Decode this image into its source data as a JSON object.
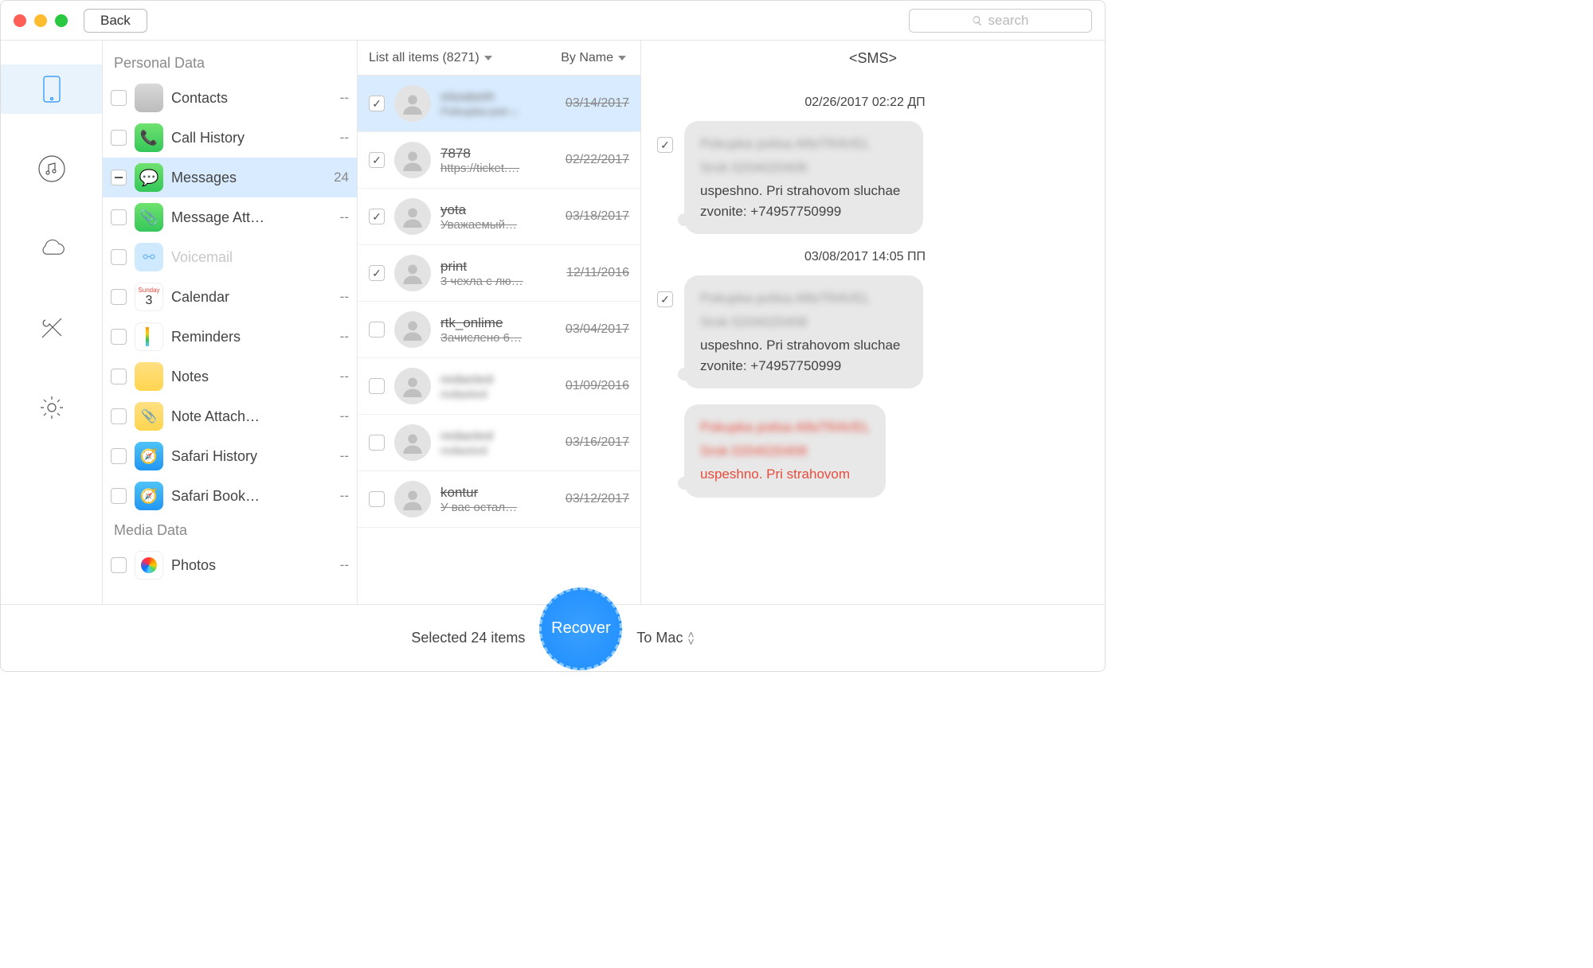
{
  "toolbar": {
    "back": "Back",
    "search_placeholder": "search"
  },
  "sections": {
    "personal": "Personal Data",
    "media": "Media Data"
  },
  "categories_personal": [
    {
      "label": "Contacts",
      "count": "--",
      "icon": "ic-contacts"
    },
    {
      "label": "Call History",
      "count": "--",
      "icon": "ic-call"
    },
    {
      "label": "Messages",
      "count": "24",
      "icon": "ic-messages",
      "selected": true,
      "checked": "minus"
    },
    {
      "label": "Message Att…",
      "count": "--",
      "icon": "ic-msgatt"
    },
    {
      "label": "Voicemail",
      "count": "",
      "icon": "ic-voicemail",
      "disabled": true
    },
    {
      "label": "Calendar",
      "count": "--",
      "icon": "ic-calendar"
    },
    {
      "label": "Reminders",
      "count": "--",
      "icon": "ic-reminders"
    },
    {
      "label": "Notes",
      "count": "--",
      "icon": "ic-notes"
    },
    {
      "label": "Note Attach…",
      "count": "--",
      "icon": "ic-noteatt"
    },
    {
      "label": "Safari History",
      "count": "--",
      "icon": "ic-safari"
    },
    {
      "label": "Safari Book…",
      "count": "--",
      "icon": "ic-safaribm"
    }
  ],
  "categories_media": [
    {
      "label": "Photos",
      "count": "--",
      "icon": "ic-photos"
    }
  ],
  "list_header": {
    "filter": "List all items (8271)",
    "sort": "By Name"
  },
  "threads": [
    {
      "title": "elizabeth",
      "preview": "Pokupka pol…",
      "date": "03/14/2017",
      "checked": true,
      "selected": true,
      "blurred": true
    },
    {
      "title": "7878",
      "preview": "https://ticket.…",
      "date": "02/22/2017",
      "checked": true
    },
    {
      "title": "yota",
      "preview": "Уважаемый…",
      "date": "03/18/2017",
      "checked": true
    },
    {
      "title": "print",
      "preview": "3 чехла с лю…",
      "date": "12/11/2016",
      "checked": true
    },
    {
      "title": "rtk_onlime",
      "preview": "Зачислено 6…",
      "date": "03/04/2017"
    },
    {
      "title": "redacted",
      "preview": "redacted",
      "date": "01/09/2016",
      "blurred": true
    },
    {
      "title": "redacted",
      "preview": "redacted",
      "date": "03/16/2017",
      "blurred": true
    },
    {
      "title": "kontur",
      "preview": "У вас остал…",
      "date": "03/12/2017"
    }
  ],
  "detail": {
    "title": "<SMS>",
    "messages": [
      {
        "timestamp": "02/26/2017 02:22 ДП",
        "blur1": "Pokupka polisa AlfaTRAVEL",
        "blur2": "Srok 0204020408",
        "text": "uspeshno. Pri strahovom sluchae zvonite: +74957750999",
        "checked": true
      },
      {
        "timestamp": "03/08/2017 14:05 ПП",
        "blur1": "Pokupka polisa AlfaTRAVEL",
        "blur2": "Srok 0204020408",
        "text": "uspeshno. Pri strahovom sluchae zvonite: +74957750999",
        "checked": true
      },
      {
        "timestamp": "",
        "blur1": "Pokupka polisa AlfaTRAVEL",
        "blur2": "Srok 0204020408",
        "text": "uspeshno. Pri strahovom",
        "red": true
      }
    ]
  },
  "footer": {
    "selected": "Selected 24 items",
    "recover": "Recover",
    "dest": "To Mac"
  }
}
